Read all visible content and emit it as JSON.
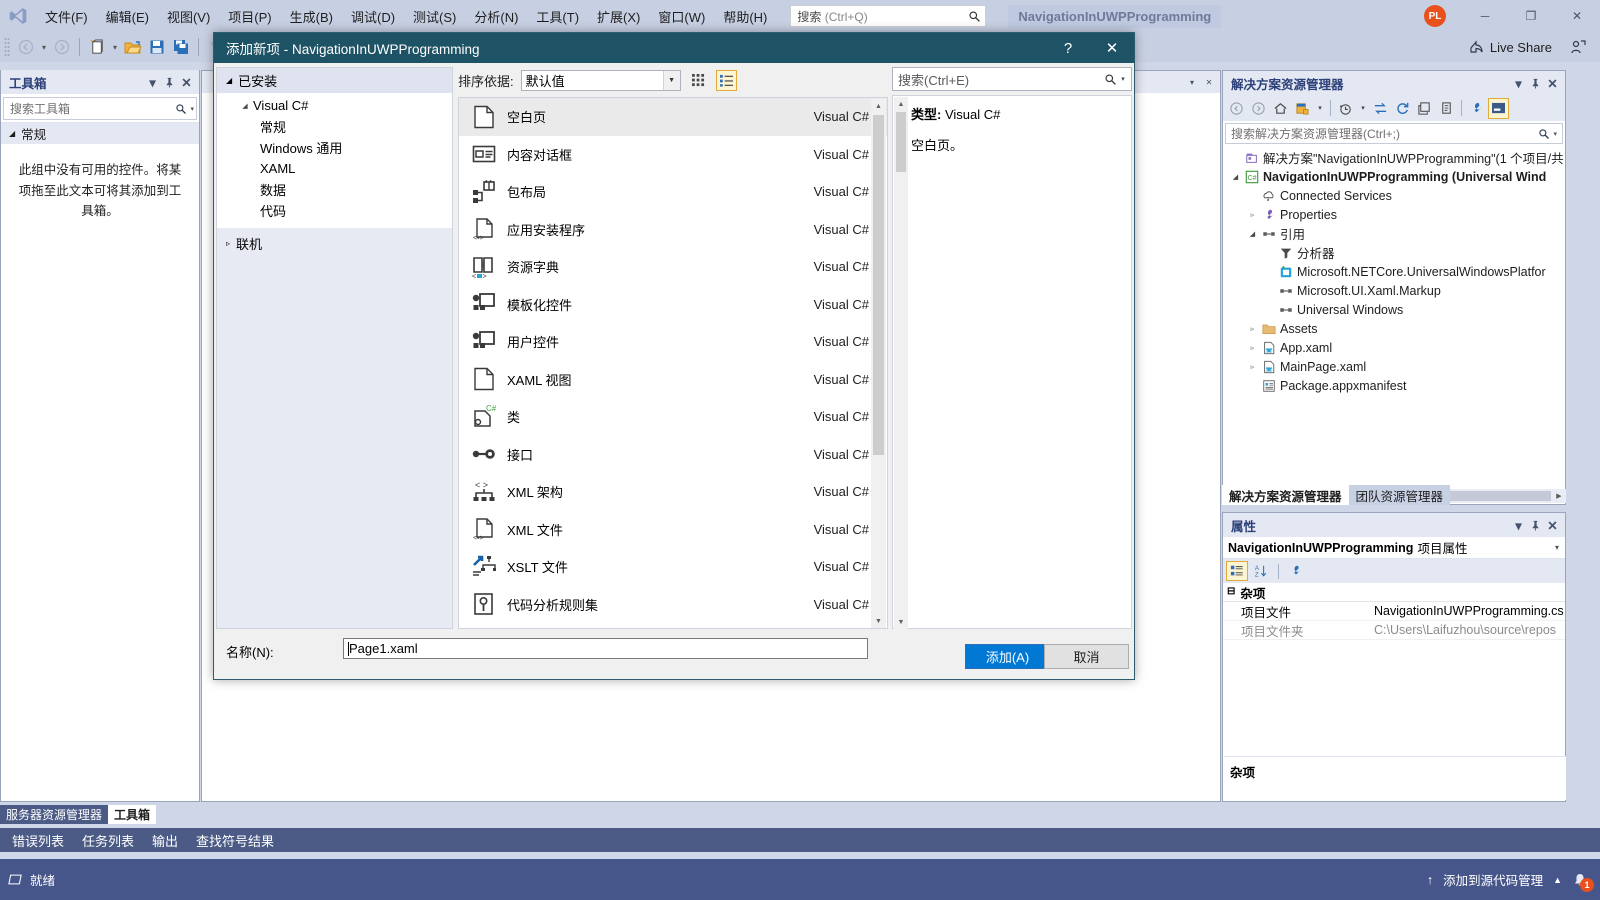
{
  "window": {
    "title_chip": "NavigationInUWPProgramming",
    "avatar_initials": "PL",
    "minimize": "─",
    "maximize": "❐",
    "close": "✕"
  },
  "menu": {
    "items": [
      {
        "label": "文件(F)"
      },
      {
        "label": "编辑(E)"
      },
      {
        "label": "视图(V)"
      },
      {
        "label": "项目(P)"
      },
      {
        "label": "生成(B)"
      },
      {
        "label": "调试(D)"
      },
      {
        "label": "测试(S)"
      },
      {
        "label": "分析(N)"
      },
      {
        "label": "工具(T)"
      },
      {
        "label": "扩展(X)"
      },
      {
        "label": "窗口(W)"
      },
      {
        "label": "帮助(H)"
      }
    ],
    "quick_search": {
      "label": "搜索",
      "hint": "(Ctrl+Q)"
    }
  },
  "toolbar": {
    "live_share": "Live Share"
  },
  "toolbox": {
    "title": "工具箱",
    "search_placeholder": "搜索工具箱",
    "group_label": "常规",
    "empty_message": "此组中没有可用的控件。将某项拖至此文本可将其添加到工具箱。",
    "tabs": [
      {
        "label": "服务器资源管理器",
        "active": false
      },
      {
        "label": "工具箱",
        "active": true
      }
    ]
  },
  "bottom_tabs": [
    {
      "label": "错误列表"
    },
    {
      "label": "任务列表"
    },
    {
      "label": "输出"
    },
    {
      "label": "查找符号结果"
    }
  ],
  "statusbar": {
    "ready": "就绪",
    "source_control": "添加到源代码管理",
    "notification_count": "1"
  },
  "solution_explorer": {
    "title": "解决方案资源管理器",
    "search_placeholder": "搜索解决方案资源管理器(Ctrl+;)",
    "tree": [
      {
        "label": "解决方案\"NavigationInUWPProgramming\"(1 个项目/共",
        "indent": 0,
        "expander": "",
        "icon": "solution-icon",
        "bold": false
      },
      {
        "label": "NavigationInUWPProgramming (Universal Wind",
        "indent": 0,
        "expander": "◢",
        "icon": "csharp-project-icon",
        "bold": true
      },
      {
        "label": "Connected Services",
        "indent": 1,
        "expander": "",
        "icon": "connected-services-icon",
        "bold": false
      },
      {
        "label": "Properties",
        "indent": 1,
        "expander": "▹",
        "icon": "wrench-icon",
        "bold": false
      },
      {
        "label": "引用",
        "indent": 1,
        "expander": "◢",
        "icon": "references-icon",
        "bold": false
      },
      {
        "label": "分析器",
        "indent": 2,
        "expander": "",
        "icon": "analyzer-icon",
        "bold": false
      },
      {
        "label": "Microsoft.NETCore.UniversalWindowsPlatfor",
        "indent": 2,
        "expander": "",
        "icon": "package-icon",
        "bold": false
      },
      {
        "label": "Microsoft.UI.Xaml.Markup",
        "indent": 2,
        "expander": "",
        "icon": "references-icon",
        "bold": false
      },
      {
        "label": "Universal Windows",
        "indent": 2,
        "expander": "",
        "icon": "references-icon",
        "bold": false
      },
      {
        "label": "Assets",
        "indent": 1,
        "expander": "▹",
        "icon": "folder-icon",
        "bold": false
      },
      {
        "label": "App.xaml",
        "indent": 1,
        "expander": "▹",
        "icon": "xaml-file-icon",
        "bold": false
      },
      {
        "label": "MainPage.xaml",
        "indent": 1,
        "expander": "▹",
        "icon": "xaml-file-icon",
        "bold": false
      },
      {
        "label": "Package.appxmanifest",
        "indent": 1,
        "expander": "",
        "icon": "manifest-icon",
        "bold": false
      }
    ],
    "tabs": [
      {
        "label": "解决方案资源管理器",
        "active": true
      },
      {
        "label": "团队资源管理器",
        "active": false
      }
    ]
  },
  "properties": {
    "title": "属性",
    "object_name": "NavigationInUWPProgramming",
    "object_suffix": "项目属性",
    "category": "杂项",
    "rows": [
      {
        "key": "项目文件",
        "value": "NavigationInUWPProgramming.cs",
        "dim": false
      },
      {
        "key": "项目文件夹",
        "value": "C:\\Users\\Laifuzhou\\source\\repos",
        "dim": true
      }
    ],
    "footer": "杂项"
  },
  "dialog": {
    "title": "添加新项 - NavigationInUWPProgramming",
    "help_glyph": "?",
    "close_glyph": "✕",
    "left": {
      "installed_label": "已安装",
      "root": "Visual C#",
      "categories": [
        {
          "label": "常规"
        },
        {
          "label": "Windows 通用"
        },
        {
          "label": "XAML"
        },
        {
          "label": "数据"
        },
        {
          "label": "代码"
        }
      ],
      "online_label": "联机"
    },
    "sort": {
      "label": "排序依据:",
      "value": "默认值"
    },
    "search_placeholder": "搜索(Ctrl+E)",
    "templates": [
      {
        "name": "空白页",
        "lang": "Visual C#",
        "icon": "blank-page-icon",
        "selected": true
      },
      {
        "name": "内容对话框",
        "lang": "Visual C#",
        "icon": "content-dialog-icon",
        "selected": false
      },
      {
        "name": "包布局",
        "lang": "Visual C#",
        "icon": "package-layout-icon",
        "selected": false
      },
      {
        "name": "应用安装程序",
        "lang": "Visual C#",
        "icon": "app-installer-icon",
        "selected": false
      },
      {
        "name": "资源字典",
        "lang": "Visual C#",
        "icon": "resource-dictionary-icon",
        "selected": false
      },
      {
        "name": "模板化控件",
        "lang": "Visual C#",
        "icon": "templated-control-icon",
        "selected": false
      },
      {
        "name": "用户控件",
        "lang": "Visual C#",
        "icon": "user-control-icon",
        "selected": false
      },
      {
        "name": "XAML 视图",
        "lang": "Visual C#",
        "icon": "xaml-view-icon",
        "selected": false
      },
      {
        "name": "类",
        "lang": "Visual C#",
        "icon": "class-icon",
        "selected": false
      },
      {
        "name": "接口",
        "lang": "Visual C#",
        "icon": "interface-icon",
        "selected": false
      },
      {
        "name": "XML 架构",
        "lang": "Visual C#",
        "icon": "xml-schema-icon",
        "selected": false
      },
      {
        "name": "XML 文件",
        "lang": "Visual C#",
        "icon": "xml-file-icon",
        "selected": false
      },
      {
        "name": "XSLT 文件",
        "lang": "Visual C#",
        "icon": "xslt-file-icon",
        "selected": false
      },
      {
        "name": "代码分析规则集",
        "lang": "Visual C#",
        "icon": "ruleset-icon",
        "selected": false
      }
    ],
    "info": {
      "type_label": "类型:",
      "type_value": "Visual C#",
      "description": "空白页。"
    },
    "footer": {
      "name_label": "名称(N):",
      "name_value": "Page1.xaml",
      "add_button": "添加(A)",
      "cancel_button": "取消"
    }
  },
  "colors": {
    "dialog_title_bg": "#1e5265",
    "accent_blue": "#0078d4",
    "chrome_bg": "#c7d0e3",
    "status_bg": "#46568b",
    "avatar_bg": "#e8501e"
  }
}
